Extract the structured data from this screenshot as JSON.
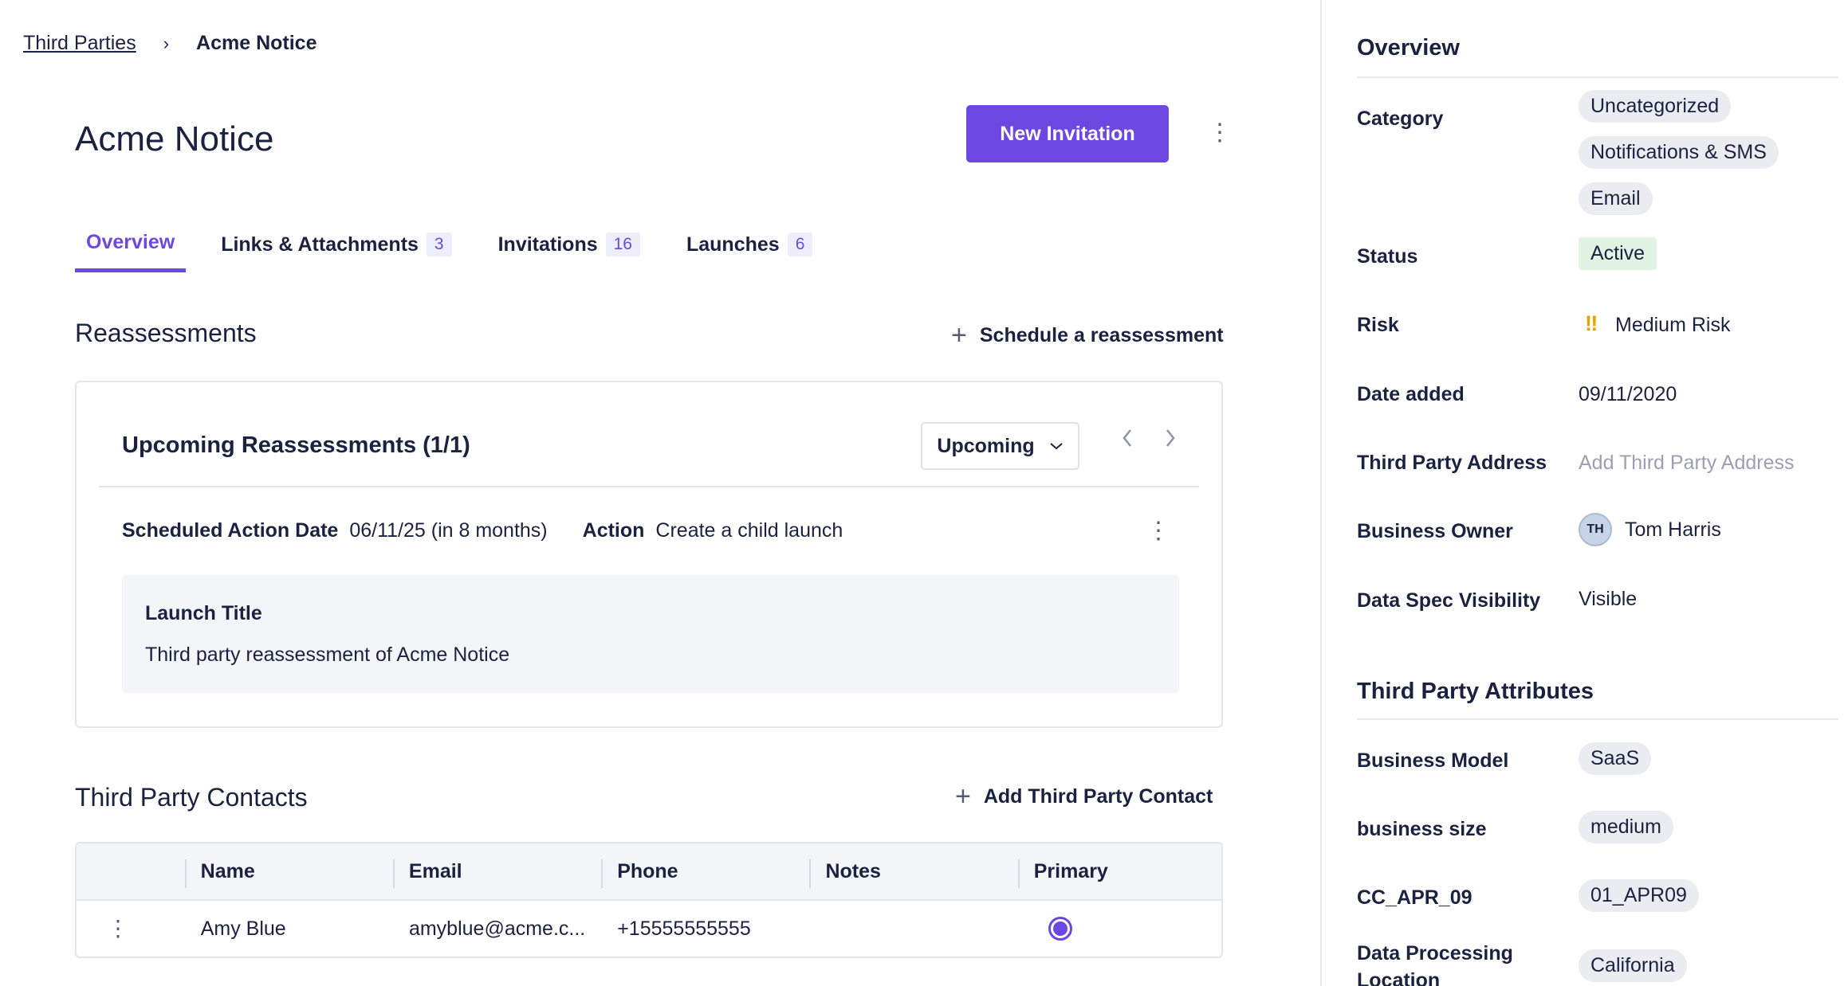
{
  "breadcrumb": {
    "parent": "Third Parties",
    "separator": "›",
    "current": "Acme Notice"
  },
  "page": {
    "title": "Acme Notice",
    "new_invitation_label": "New Invitation",
    "more_icon": "⋮"
  },
  "tabs": [
    {
      "label": "Overview",
      "count": ""
    },
    {
      "label": "Links & Attachments",
      "count": "3"
    },
    {
      "label": "Invitations",
      "count": "16"
    },
    {
      "label": "Launches",
      "count": "6"
    }
  ],
  "reassessments": {
    "heading": "Reassessments",
    "schedule_label": "Schedule a reassessment",
    "card": {
      "title": "Upcoming Reassessments (1/1)",
      "filter_value": "Upcoming",
      "scheduled_label": "Scheduled Action Date",
      "scheduled_value": "06/11/25 (in 8 months)",
      "action_label": "Action",
      "action_value": "Create a child launch",
      "launch_title_label": "Launch Title",
      "launch_title_value": "Third party reassessment of Acme Notice"
    }
  },
  "contacts": {
    "heading": "Third Party Contacts",
    "add_label": "Add Third Party Contact",
    "columns": [
      "Name",
      "Email",
      "Phone",
      "Notes",
      "Primary"
    ],
    "rows": [
      {
        "name": "Amy Blue",
        "email": "amyblue@acme.c...",
        "phone": "+15555555555",
        "notes": "",
        "primary": true
      }
    ]
  },
  "overview": {
    "heading": "Overview",
    "category_label": "Category",
    "categories": [
      "Uncategorized",
      "Notifications & SMS",
      "Email"
    ],
    "status_label": "Status",
    "status_value": "Active",
    "risk_label": "Risk",
    "risk_icon": "‼",
    "risk_value": "Medium Risk",
    "date_label": "Date added",
    "date_value": "09/11/2020",
    "address_label": "Third Party Address",
    "address_placeholder": "Add Third Party Address",
    "owner_label": "Business Owner",
    "owner_initials": "TH",
    "owner_name": "Tom Harris",
    "visibility_label": "Data Spec Visibility",
    "visibility_value": "Visible"
  },
  "attributes": {
    "heading": "Third Party Attributes",
    "items": [
      {
        "label": "Business Model",
        "value": "SaaS"
      },
      {
        "label": "business size",
        "value": "medium"
      },
      {
        "label": "CC_APR_09",
        "value": "01_APR09"
      },
      {
        "label": "Data Processing Location",
        "value": "California"
      }
    ]
  },
  "colors": {
    "accent": "#6c47e0",
    "text": "#1b2240",
    "active_bg": "#e1f3e3",
    "risk": "#e2a400"
  }
}
